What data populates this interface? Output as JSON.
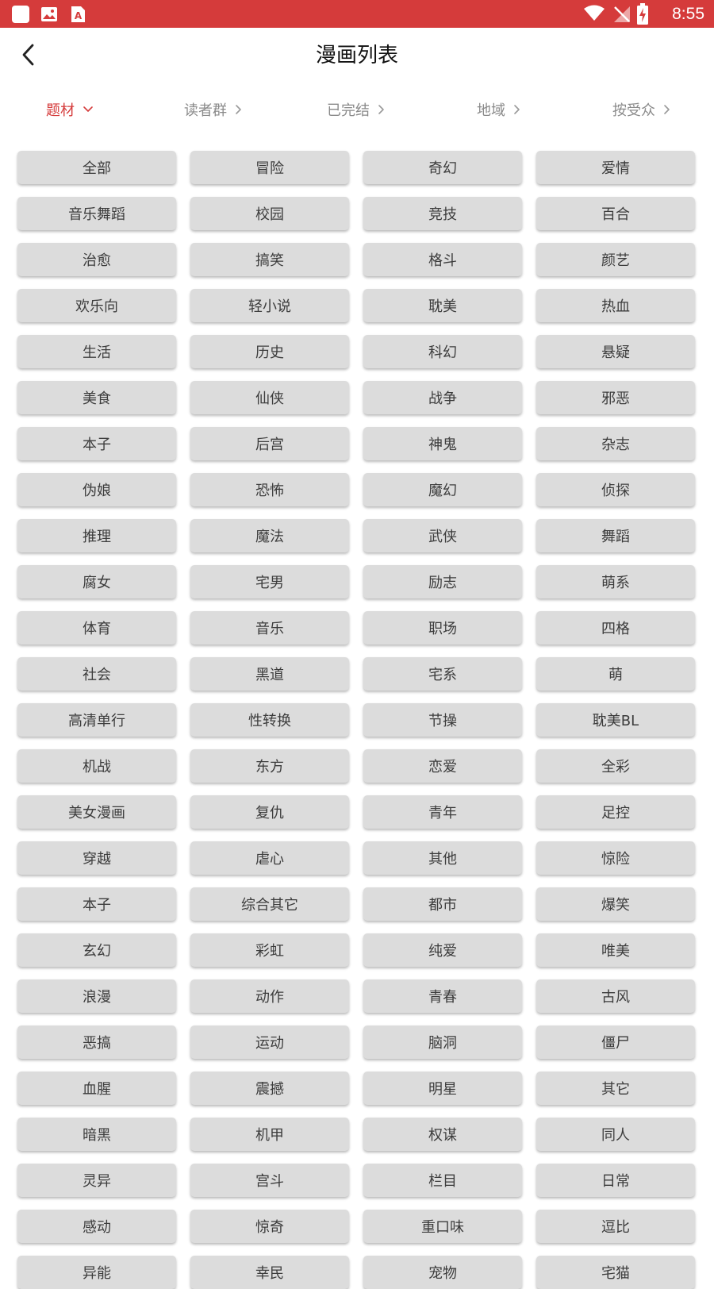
{
  "status_bar": {
    "time": "8:55",
    "left_icons": [
      "app-square-icon",
      "image-icon",
      "text-a-icon"
    ],
    "right_icons": [
      "wifi-icon",
      "no-signal-icon",
      "battery-charging-icon"
    ],
    "color": "#d53b3b"
  },
  "header": {
    "title": "漫画列表",
    "back_icon": "chevron-left-icon"
  },
  "filters": [
    {
      "label": "题材",
      "active": true,
      "chevron": "chevron-down-icon"
    },
    {
      "label": "读者群",
      "active": false,
      "chevron": "chevron-right-icon"
    },
    {
      "label": "已完结",
      "active": false,
      "chevron": "chevron-right-icon"
    },
    {
      "label": "地域",
      "active": false,
      "chevron": "chevron-right-icon"
    },
    {
      "label": "按受众",
      "active": false,
      "chevron": "chevron-right-icon"
    }
  ],
  "accent_color": "#d53b3b",
  "tags": [
    "全部",
    "冒险",
    "奇幻",
    "爱情",
    "音乐舞蹈",
    "校园",
    "竞技",
    "百合",
    "治愈",
    "搞笑",
    "格斗",
    "颜艺",
    "欢乐向",
    "轻小说",
    "耽美",
    "热血",
    "生活",
    "历史",
    "科幻",
    "悬疑",
    "美食",
    "仙侠",
    "战争",
    "邪恶",
    "本子",
    "后宫",
    "神鬼",
    "杂志",
    "伪娘",
    "恐怖",
    "魔幻",
    "侦探",
    "推理",
    "魔法",
    "武侠",
    "舞蹈",
    "腐女",
    "宅男",
    "励志",
    "萌系",
    "体育",
    "音乐",
    "职场",
    "四格",
    "社会",
    "黑道",
    "宅系",
    "萌",
    "高清单行",
    "性转换",
    "节操",
    "耽美BL",
    "机战",
    "东方",
    "恋爱",
    "全彩",
    "美女漫画",
    "复仇",
    "青年",
    "足控",
    "穿越",
    "虐心",
    "其他",
    "惊险",
    "本子",
    "综合其它",
    "都市",
    "爆笑",
    "玄幻",
    "彩虹",
    "纯爱",
    "唯美",
    "浪漫",
    "动作",
    "青春",
    "古风",
    "恶搞",
    "运动",
    "脑洞",
    "僵尸",
    "血腥",
    "震撼",
    "明星",
    "其它",
    "暗黑",
    "机甲",
    "权谋",
    "同人",
    "灵异",
    "宫斗",
    "栏目",
    "日常",
    "感动",
    "惊奇",
    "重口味",
    "逗比",
    "异能",
    "幸民",
    "宠物",
    "宅猫"
  ]
}
